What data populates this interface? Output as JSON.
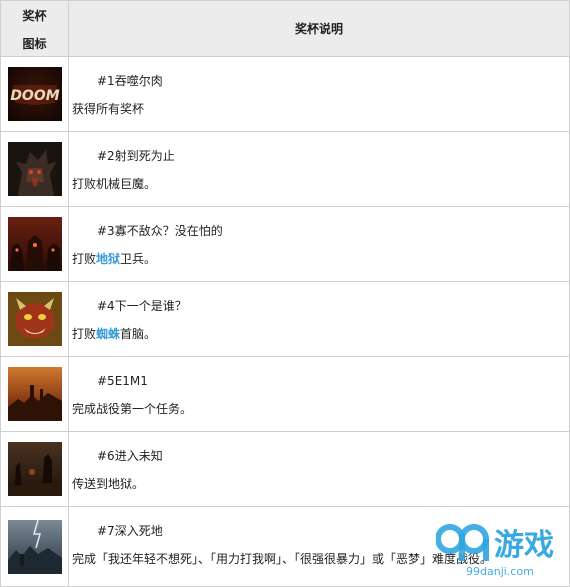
{
  "header": {
    "icon_line1": "奖杯",
    "icon_line2": "图标",
    "desc": "奖杯说明"
  },
  "trophies": [
    {
      "name": "#1吞噬尔肉",
      "desc_before": "获得所有奖杯",
      "desc_hl": "",
      "desc_after": "",
      "icon": "doom-logo-icon"
    },
    {
      "name": "#2射到死为止",
      "desc_before": "打败机械巨魔。",
      "desc_hl": "",
      "desc_after": "",
      "icon": "mech-demon-icon"
    },
    {
      "name": "#3寡不敌众？没在怕的",
      "desc_before": "打败",
      "desc_hl": "地狱",
      "desc_after": "卫兵。",
      "icon": "hell-guards-icon"
    },
    {
      "name": "#4下一个是谁？",
      "desc_before": "打败",
      "desc_hl": "蜘蛛",
      "desc_after": "首脑。",
      "icon": "spider-mastermind-icon"
    },
    {
      "name": "#5E1M1",
      "desc_before": "完成战役第一个任务。",
      "desc_hl": "",
      "desc_after": "",
      "icon": "mars-base-icon"
    },
    {
      "name": "#6进入未知",
      "desc_before": "传送到地狱。",
      "desc_hl": "",
      "desc_after": "",
      "icon": "hell-landscape-icon"
    },
    {
      "name": "#7深入死地",
      "desc_before": "完成「我还年轻不想死」、「用力打我啊」、「很强很暴力」或「恶梦」难度战役。",
      "desc_hl": "",
      "desc_after": "",
      "icon": "storm-ruins-icon"
    }
  ],
  "watermark": {
    "brand": "游戏",
    "site": "99danji.com"
  },
  "colors": {
    "highlight": "#3a9bd9",
    "header_bg": "#ececec",
    "border": "#d0d0d0"
  }
}
